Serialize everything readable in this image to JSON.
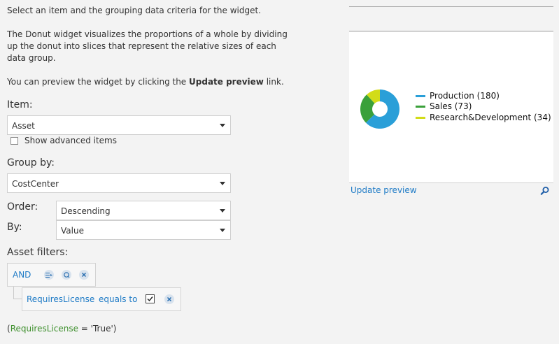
{
  "intro": {
    "line1": "Select an item and the grouping data criteria for the widget.",
    "line2": "The Donut widget visualizes the proportions of a whole by dividing up the donut into slices that represent the relative sizes of each data group.",
    "line3_prefix": "You can preview the widget by clicking the ",
    "line3_bold": "Update preview",
    "line3_suffix": " link."
  },
  "item": {
    "label": "Item:",
    "value": "Asset",
    "show_advanced_label": "Show advanced items",
    "show_advanced_checked": false
  },
  "group_by": {
    "label": "Group by:",
    "value": "CostCenter"
  },
  "order": {
    "label": "Order:",
    "value": "Descending"
  },
  "by": {
    "label": "By:",
    "value": "Value"
  },
  "filters": {
    "label": "Asset filters:",
    "operator": "AND",
    "condition_field": "RequiresLicense",
    "condition_op": "equals to",
    "condition_checked": true,
    "expression_open": "(",
    "expression_field": "RequiresLicense",
    "expression_rest": " = 'True')"
  },
  "preview": {
    "update_link": "Update preview",
    "search_icon": "search-icon"
  },
  "colors": {
    "production": "#2a9fd8",
    "sales": "#3aa03a",
    "rnd": "#d2dc19",
    "link": "#1f7bc6",
    "expression_field": "#3d8f2c"
  },
  "chart_data": {
    "type": "pie",
    "style": "donut",
    "categories": [
      "Production",
      "Sales",
      "Research&Development"
    ],
    "values": [
      180,
      73,
      34
    ],
    "legend": [
      "Production (180)",
      "Sales (73)",
      "Research&Development (34)"
    ],
    "legend_position": "right"
  }
}
